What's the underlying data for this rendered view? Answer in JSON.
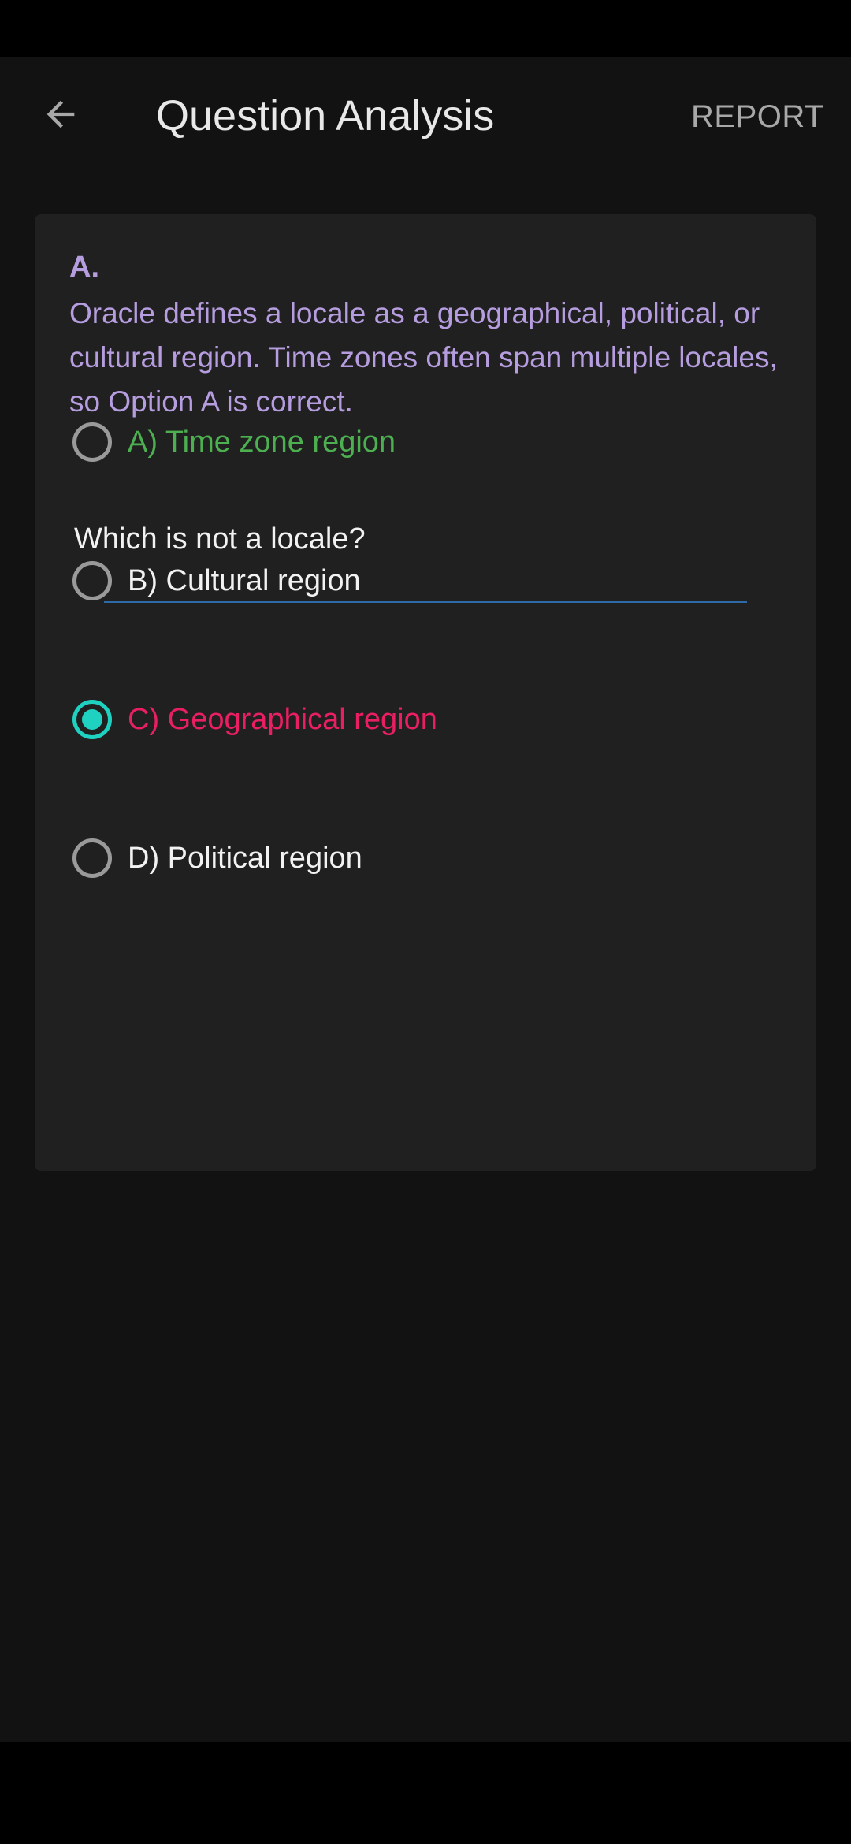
{
  "app_bar": {
    "title": "Question Analysis",
    "report_label": "REPORT",
    "back_icon": "arrow-left-icon"
  },
  "explanation": {
    "answer": "A.",
    "text": "Oracle defines a locale as a geographical, political, or cultural region. Time zones often span multiple locales, so Option A is correct."
  },
  "question": {
    "text": "Which is not a locale?"
  },
  "options": [
    {
      "label": "A) Time zone region",
      "state": "correct",
      "selected": false
    },
    {
      "label": "B) Cultural region",
      "state": "neutral",
      "selected": false
    },
    {
      "label": "C) Geographical region",
      "state": "wrong",
      "selected": true
    },
    {
      "label": "D) Political region",
      "state": "neutral",
      "selected": false
    }
  ],
  "colors": {
    "background": "#121212",
    "card": "#202020",
    "explanation_text": "#b69ddf",
    "correct": "#4caf50",
    "wrong": "#e91e63",
    "radio_selected": "#1fd1c1",
    "divider": "#2e6aa6"
  }
}
